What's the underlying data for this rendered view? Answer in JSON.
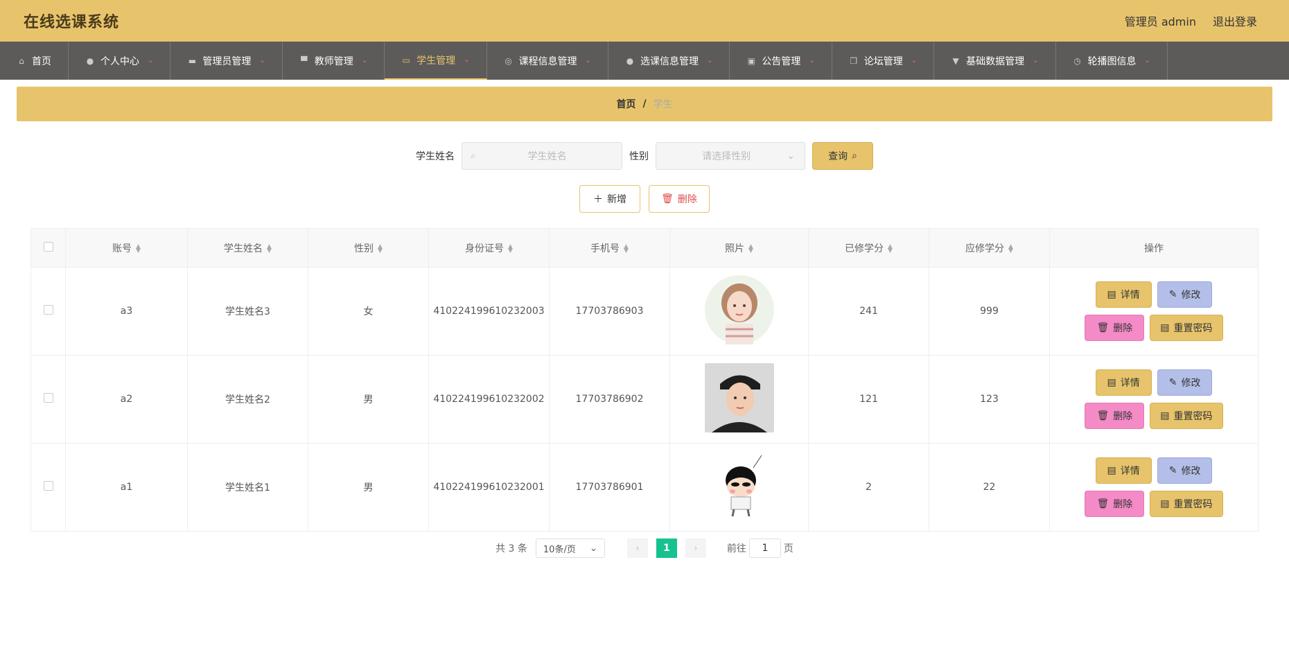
{
  "app": {
    "title": "在线选课系统",
    "user_label": "管理员 admin",
    "logout_label": "退出登录"
  },
  "nav": [
    {
      "label": "首页",
      "icon": "home-icon",
      "glyph": "⌂"
    },
    {
      "label": "个人中心",
      "icon": "person-icon",
      "glyph": "●"
    },
    {
      "label": "管理员管理",
      "icon": "ticket-icon",
      "glyph": "▬"
    },
    {
      "label": "教师管理",
      "icon": "monitor-icon",
      "glyph": "▀"
    },
    {
      "label": "学生管理",
      "icon": "chat-icon",
      "glyph": "▭"
    },
    {
      "label": "课程信息管理",
      "icon": "compass-icon",
      "glyph": "◎"
    },
    {
      "label": "选课信息管理",
      "icon": "bulb-icon",
      "glyph": "●"
    },
    {
      "label": "公告管理",
      "icon": "clipboard-icon",
      "glyph": "▣"
    },
    {
      "label": "论坛管理",
      "icon": "copy-icon",
      "glyph": "❐"
    },
    {
      "label": "基础数据管理",
      "icon": "brush-icon",
      "glyph": "▼"
    },
    {
      "label": "轮播图信息",
      "icon": "clock-icon",
      "glyph": "◷"
    }
  ],
  "breadcrumb": {
    "home": "首页",
    "separator": "/",
    "current": "学生"
  },
  "search": {
    "name_label": "学生姓名",
    "name_placeholder": "学生姓名",
    "gender_label": "性别",
    "gender_placeholder": "请选择性别",
    "query_label": "查询"
  },
  "actions": {
    "add_label": "新增",
    "delete_label": "删除"
  },
  "table": {
    "headers": [
      "账号",
      "学生姓名",
      "性别",
      "身份证号",
      "手机号",
      "照片",
      "已修学分",
      "应修学分",
      "操作"
    ],
    "rows": [
      {
        "account": "a3",
        "name": "学生姓名3",
        "gender": "女",
        "id_card": "410224199610232003",
        "phone": "17703786903",
        "photo": "girl-avatar",
        "earned": "241",
        "required": "999"
      },
      {
        "account": "a2",
        "name": "学生姓名2",
        "gender": "男",
        "id_card": "410224199610232002",
        "phone": "17703786902",
        "photo": "man-photo",
        "earned": "121",
        "required": "123"
      },
      {
        "account": "a1",
        "name": "学生姓名1",
        "gender": "男",
        "id_card": "410224199610232001",
        "phone": "17703786901",
        "photo": "cartoon-boy",
        "earned": "2",
        "required": "22"
      }
    ],
    "row_actions": {
      "detail": "详情",
      "edit": "修改",
      "delete": "删除",
      "reset": "重置密码"
    }
  },
  "pager": {
    "total": "共 3 条",
    "page_size": "10条/页",
    "current_page": "1",
    "goto_label": "前往",
    "goto_value": "1",
    "page_unit": "页"
  },
  "colors": {
    "accent": "#e7c46c",
    "nav_bg": "#5d5b59",
    "page_active": "#16c28f",
    "edit_btn": "#b3bfe8",
    "delete_btn": "#f48ac6"
  }
}
